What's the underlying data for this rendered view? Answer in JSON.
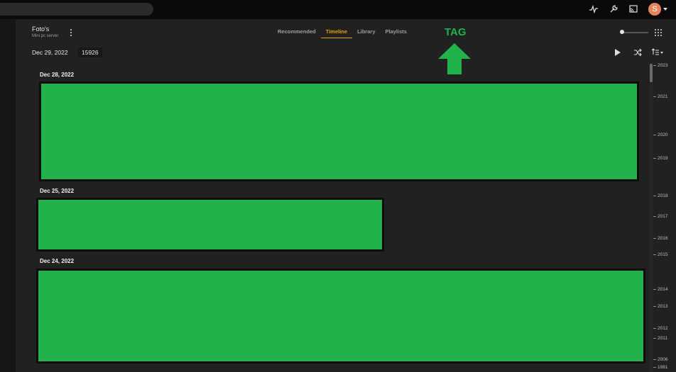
{
  "topbar": {
    "avatar_letter": "S",
    "icons": [
      "activity-icon",
      "wrench-icon",
      "cast-icon"
    ]
  },
  "library": {
    "title": "Foto's",
    "subtitle": "Mini pc server"
  },
  "tabs": [
    {
      "label": "Recommended",
      "active": false
    },
    {
      "label": "Timeline",
      "active": true
    },
    {
      "label": "Library",
      "active": false
    },
    {
      "label": "Playlists",
      "active": false
    }
  ],
  "annotation": {
    "label": "TAG",
    "color": "#22b24c"
  },
  "filter": {
    "date": "Dec 29, 2022",
    "count": "15926"
  },
  "sections": [
    {
      "date": "Dec 28, 2022"
    },
    {
      "date": "Dec 25, 2022"
    },
    {
      "date": "Dec 24, 2022"
    }
  ],
  "years": [
    "2023",
    "2021",
    "2020",
    "2019",
    "2018",
    "2017",
    "2016",
    "2015",
    "2014",
    "2013",
    "2012",
    "2011",
    "2006",
    "1981"
  ],
  "colors": {
    "accent": "#e5a00d",
    "redaction": "#22b24c",
    "avatar": "#e5845a"
  }
}
